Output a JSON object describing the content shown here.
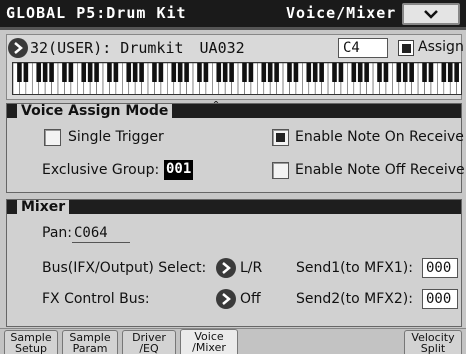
{
  "header": {
    "title": "GLOBAL P5:Drum Kit",
    "page": "Voice/Mixer"
  },
  "program": {
    "name": "32(USER): Drumkit",
    "code": "UA032",
    "key": "C4",
    "assign_label": "Assign",
    "assign_checked": true
  },
  "voice_assign": {
    "title": "Voice Assign Mode",
    "single_trigger": "Single Trigger",
    "enable_note_on": "Enable Note On Receive",
    "exclusive_group_label": "Exclusive Group:",
    "exclusive_group_value": "001",
    "enable_note_off": "Enable Note Off Receive"
  },
  "mixer": {
    "title": "Mixer",
    "pan_label": "Pan:",
    "pan_value": "C064",
    "bus_label": "Bus(IFX/Output) Select:",
    "bus_value": "L/R",
    "send1_label": "Send1(to MFX1):",
    "send1_value": "000",
    "fx_bus_label": "FX Control Bus:",
    "fx_bus_value": "Off",
    "send2_label": "Send2(to MFX2):",
    "send2_value": "000"
  },
  "tabs": [
    {
      "line1": "Sample",
      "line2": "Setup"
    },
    {
      "line1": "Sample",
      "line2": "Param"
    },
    {
      "line1": "Driver",
      "line2": "/EQ"
    },
    {
      "line1": "Voice",
      "line2": "/Mixer"
    },
    {
      "line1": "Velocity",
      "line2": "Split"
    }
  ]
}
